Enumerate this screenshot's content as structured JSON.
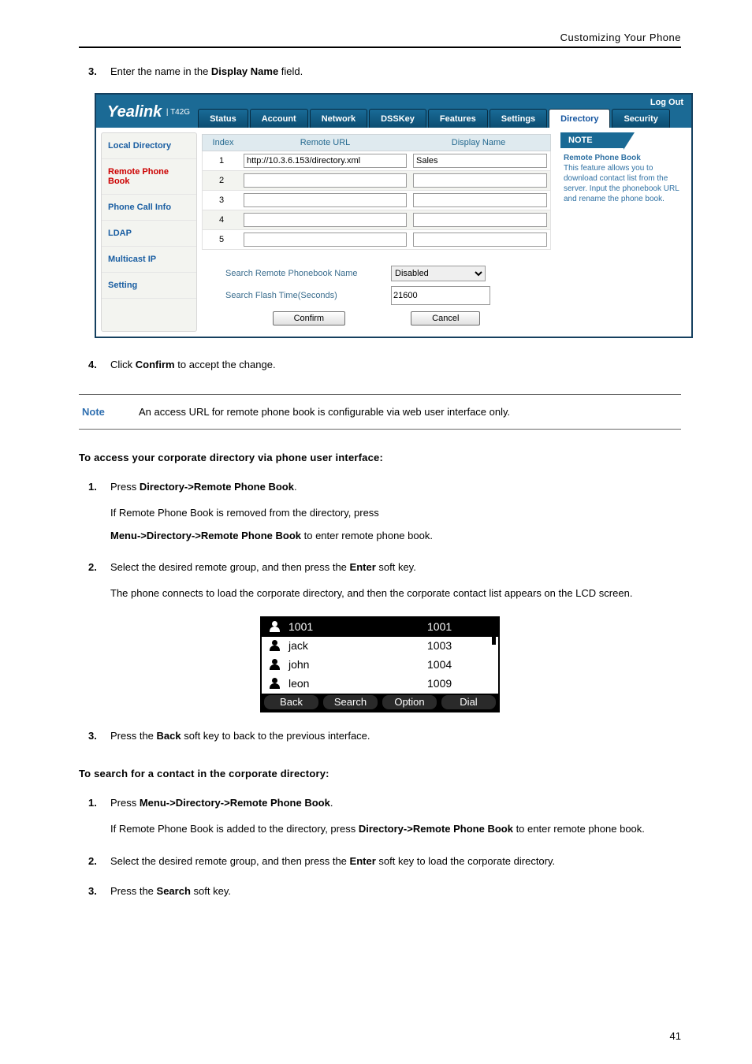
{
  "breadcrumb": "Customizing Your Phone",
  "page_number": "41",
  "step_before_shot": {
    "num": "3.",
    "pre": "Enter the name in the ",
    "bold": "Display Name",
    "post": " field."
  },
  "admin": {
    "brand": "Yealink",
    "model": "T42G",
    "logout": "Log Out",
    "tabs": [
      "Status",
      "Account",
      "Network",
      "DSSKey",
      "Features",
      "Settings",
      "Directory",
      "Security"
    ],
    "active_tab_index": 6,
    "sidebar": [
      "Local Directory",
      "Remote Phone Book",
      "Phone Call Info",
      "LDAP",
      "Multicast IP",
      "Setting"
    ],
    "grid_headers": {
      "idx": "Index",
      "url": "Remote URL",
      "disp": "Display Name"
    },
    "rows": [
      {
        "idx": "1",
        "url": "http://10.3.6.153/directory.xml",
        "display": "Sales"
      },
      {
        "idx": "2",
        "url": "",
        "display": ""
      },
      {
        "idx": "3",
        "url": "",
        "display": ""
      },
      {
        "idx": "4",
        "url": "",
        "display": ""
      },
      {
        "idx": "5",
        "url": "",
        "display": ""
      }
    ],
    "search_name_label": "Search Remote Phonebook Name",
    "search_name_value": "Disabled",
    "flash_label": "Search Flash Time(Seconds)",
    "flash_value": "21600",
    "confirm": "Confirm",
    "cancel": "Cancel",
    "note_tab": "NOTE",
    "note_title": "Remote Phone Book",
    "note_text": "This feature allows you to download contact list from the server. Input the phonebook URL and rename the phone book."
  },
  "step_confirm": {
    "num": "4.",
    "pre": "Click ",
    "bold": "Confirm",
    "post": " to accept the change."
  },
  "note_block": {
    "label": "Note",
    "text": "An access URL for remote phone book is configurable via web user interface only."
  },
  "section1": "To access your corporate directory via phone user interface:",
  "item1_1": {
    "num": "1.",
    "pre": "Press ",
    "bold": "Directory->Remote Phone Book",
    "post": "."
  },
  "item1_1_body_a": "If Remote Phone Book is removed from the directory, press",
  "item1_1_body_bold": "Menu->Directory->Remote Phone Book",
  "item1_1_body_b": " to enter remote phone book.",
  "item1_2": {
    "num": "2.",
    "pre": "Select the desired remote group, and then press the ",
    "bold": "Enter",
    "post": " soft key."
  },
  "item1_2_body": "The phone connects to load the corporate directory, and then the corporate contact list appears on the LCD screen.",
  "lcd": {
    "rows": [
      {
        "name": "1001",
        "number": "1001",
        "selected": true
      },
      {
        "name": "jack",
        "number": "1003",
        "selected": false
      },
      {
        "name": "john",
        "number": "1004",
        "selected": false
      },
      {
        "name": "leon",
        "number": "1009",
        "selected": false
      }
    ],
    "softkeys": [
      "Back",
      "Search",
      "Option",
      "Dial"
    ]
  },
  "item1_3": {
    "num": "3.",
    "pre": "Press the ",
    "bold": "Back",
    "post": " soft key to back to the previous interface."
  },
  "section2": "To search for a contact in the corporate directory:",
  "item2_1": {
    "num": "1.",
    "pre": "Press ",
    "bold": "Menu->Directory->Remote Phone Book",
    "post": "."
  },
  "item2_1_body_a": "If Remote Phone Book is added to the directory, press ",
  "item2_1_body_bold": "Directory->Remote Phone Book",
  "item2_1_body_b": " to enter remote phone book.",
  "item2_2": {
    "num": "2.",
    "pre": "Select the desired remote group, and then press the ",
    "bold": "Enter",
    "post": " soft key to load the corporate directory."
  },
  "item2_3": {
    "num": "3.",
    "pre": "Press the ",
    "bold": "Search",
    "post": " soft key."
  }
}
